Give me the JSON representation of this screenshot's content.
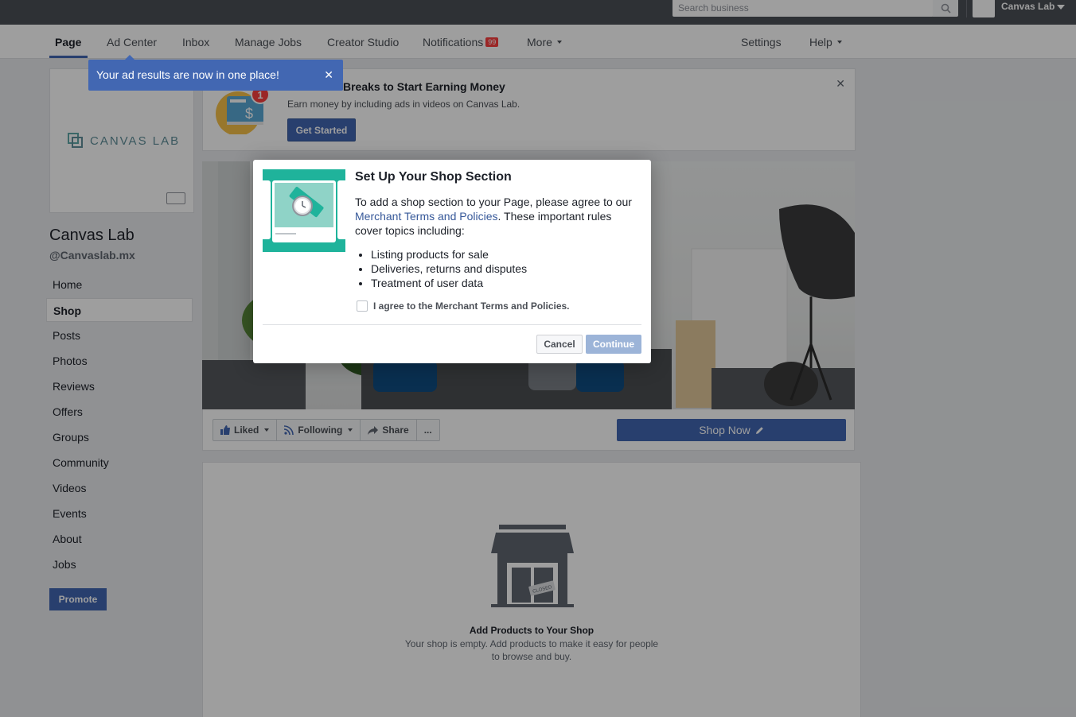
{
  "topbar": {
    "search_placeholder": "Search business",
    "account_name": "Canvas Lab"
  },
  "nav": {
    "items": [
      {
        "label": "Page"
      },
      {
        "label": "Ad Center"
      },
      {
        "label": "Inbox"
      },
      {
        "label": "Manage Jobs"
      },
      {
        "label": "Creator Studio"
      },
      {
        "label": "Notifications"
      },
      {
        "label": "More"
      },
      {
        "label": "Settings"
      },
      {
        "label": "Help"
      }
    ],
    "notifications_badge": "99"
  },
  "tooltip": {
    "text": "Your ad results are now in one place!"
  },
  "profile": {
    "logo_text": "CANVAS LAB",
    "page_name": "Canvas Lab",
    "handle": "@Canvaslab.mx"
  },
  "sidebar": {
    "items": [
      {
        "label": "Home"
      },
      {
        "label": "Shop"
      },
      {
        "label": "Posts"
      },
      {
        "label": "Photos"
      },
      {
        "label": "Reviews"
      },
      {
        "label": "Offers"
      },
      {
        "label": "Groups"
      },
      {
        "label": "Community"
      },
      {
        "label": "Videos"
      },
      {
        "label": "Events"
      },
      {
        "label": "About"
      },
      {
        "label": "Jobs"
      }
    ],
    "promote_label": "Promote"
  },
  "earn": {
    "title": "Breaks to Start Earning Money",
    "subtitle": "Earn money by including ads in videos on Canvas Lab.",
    "button": "Get Started",
    "badge": "1"
  },
  "actions": {
    "liked": "Liked",
    "following": "Following",
    "share": "Share",
    "more": "...",
    "shop_now": "Shop Now"
  },
  "shop": {
    "title": "Add Products to Your Shop",
    "desc": "Your shop is empty. Add products to make it easy for people to browse and buy.",
    "sign": "CLOSED"
  },
  "modal": {
    "title": "Set Up Your Shop Section",
    "body_before": "To add a shop section to your Page, please agree to our ",
    "body_link": "Merchant Terms and Policies",
    "body_after": ". These important rules cover topics including:",
    "list": [
      "Listing products for sale",
      "Deliveries, returns and disputes",
      "Treatment of user data"
    ],
    "agree_label": "I agree to the Merchant Terms and Policies.",
    "cancel": "Cancel",
    "continue": "Continue"
  },
  "colors": {
    "brand": "#4267b2",
    "topbar": "#4b4f56",
    "teal": "#1fb39b",
    "badge_red": "#fa3e3e",
    "continue_disabled": "#9cb4d8"
  }
}
